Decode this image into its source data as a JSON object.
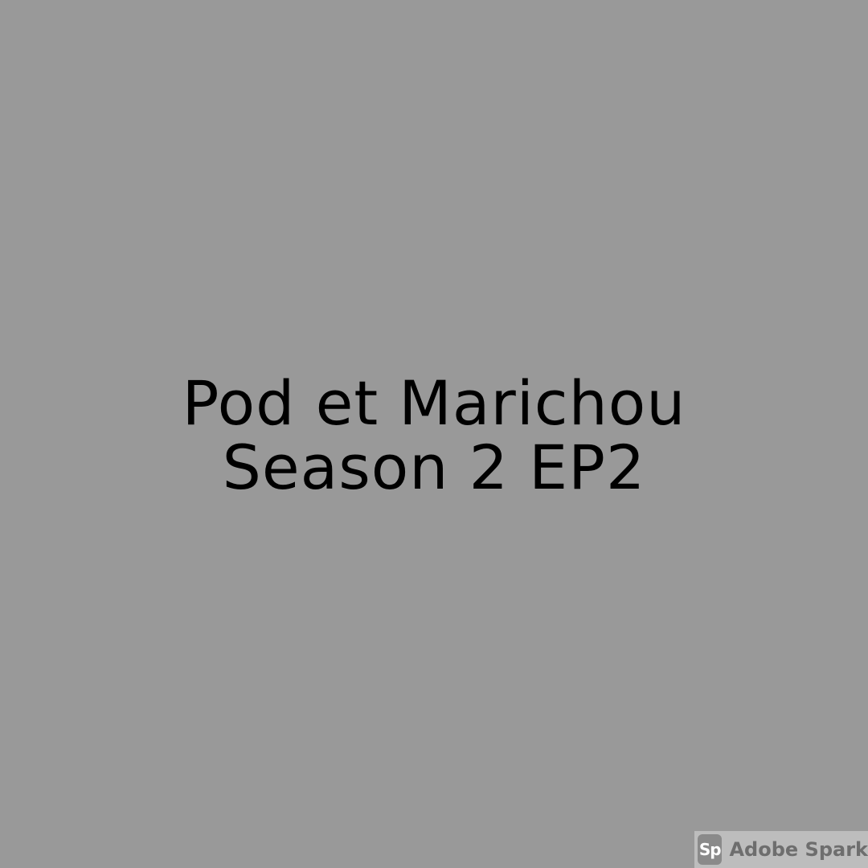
{
  "background_color": "#999999",
  "text_color": "#000000",
  "title": {
    "line1": "Pod et Marichou",
    "line2": "Season 2 EP2"
  },
  "watermark": {
    "logo_text": "Sp",
    "label": "Adobe Spark",
    "icon": "adobe-spark-logo-icon"
  }
}
